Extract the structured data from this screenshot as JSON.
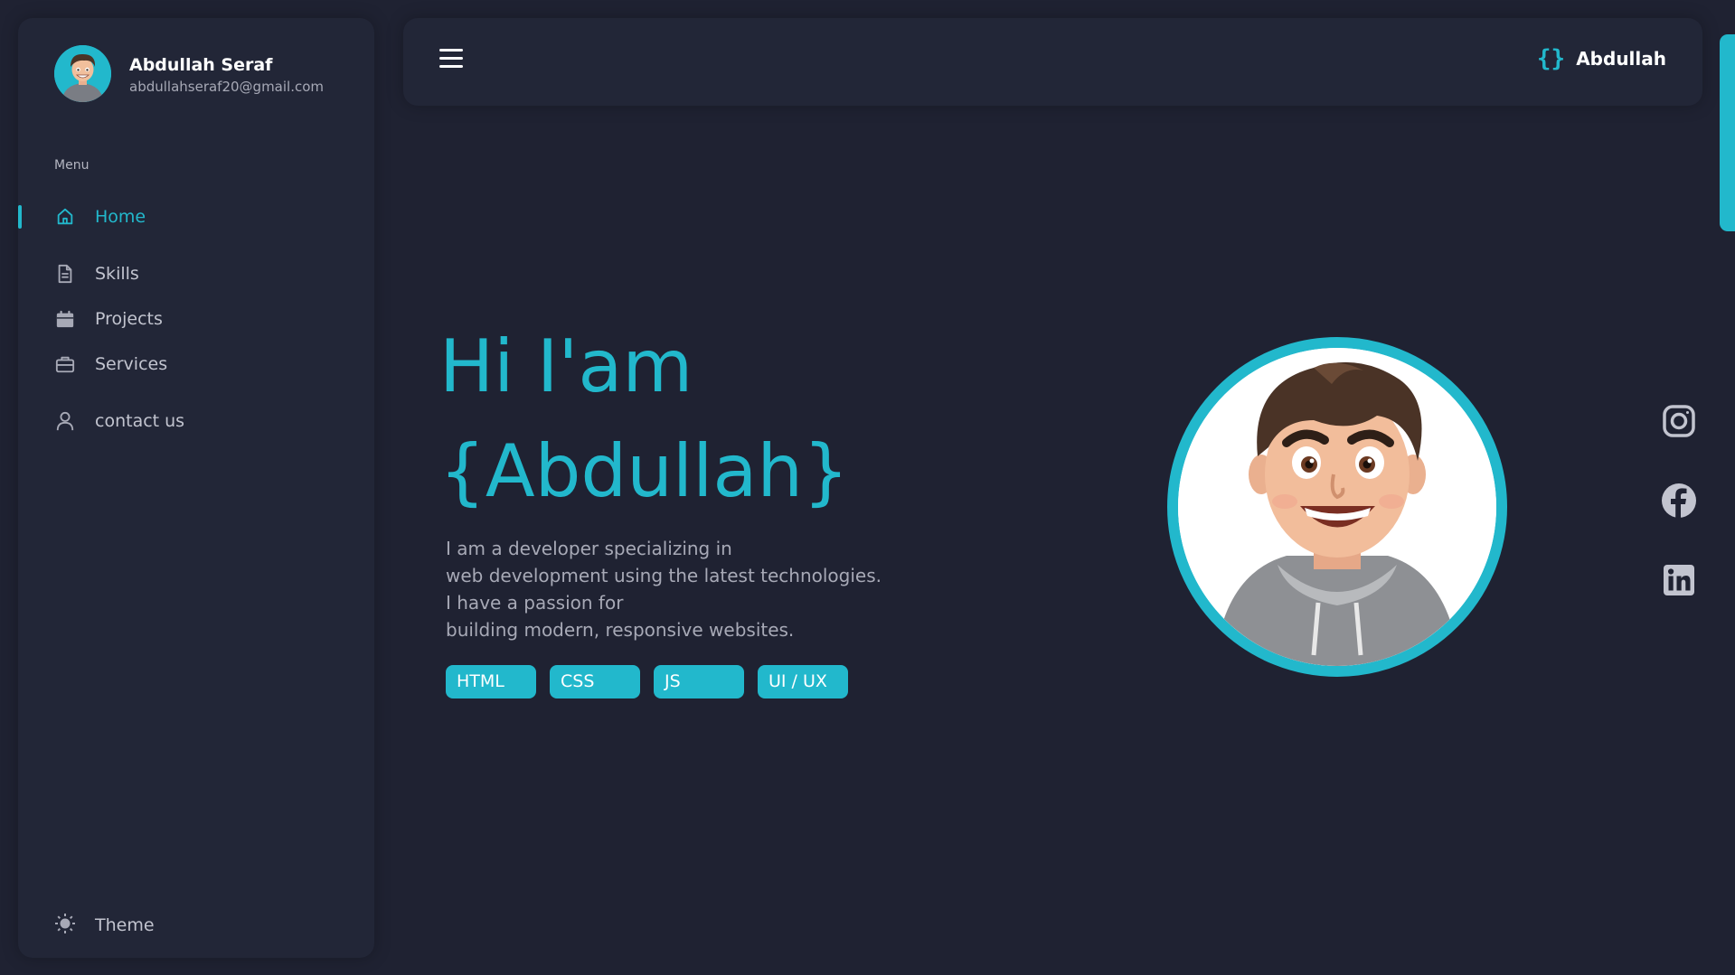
{
  "profile": {
    "name": "Abdullah Seraf",
    "email": "abdullahseraf20@gmail.com"
  },
  "menu": {
    "label": "Menu",
    "items": [
      {
        "label": "Home",
        "icon": "home-icon",
        "active": true
      },
      {
        "label": "Skills",
        "icon": "document-icon",
        "active": false
      },
      {
        "label": "Projects",
        "icon": "calendar-icon",
        "active": false
      },
      {
        "label": "Services",
        "icon": "briefcase-icon",
        "active": false
      },
      {
        "label": "contact us",
        "icon": "user-icon",
        "active": false
      }
    ]
  },
  "theme": {
    "label": "Theme",
    "icon": "sun-icon"
  },
  "topbar": {
    "menu_icon": "hamburger-icon",
    "brand_icon": "{}",
    "brand_name": "Abdullah"
  },
  "hero": {
    "greeting": "Hi I'am",
    "name": "{Abdullah}",
    "description_lines": [
      "I am a developer specializing in",
      "web development using the latest technologies.",
      "I have a passion for",
      "building modern, responsive websites."
    ],
    "tags": [
      "HTML",
      "CSS",
      "JS",
      "UI / UX"
    ]
  },
  "socials": [
    "instagram-icon",
    "facebook-icon",
    "linkedin-icon"
  ],
  "colors": {
    "accent": "#22b8cc",
    "background": "#1f2232",
    "panel": "#222637",
    "muted_text": "#a7a9b6",
    "social_icon": "#c2c4cf"
  }
}
